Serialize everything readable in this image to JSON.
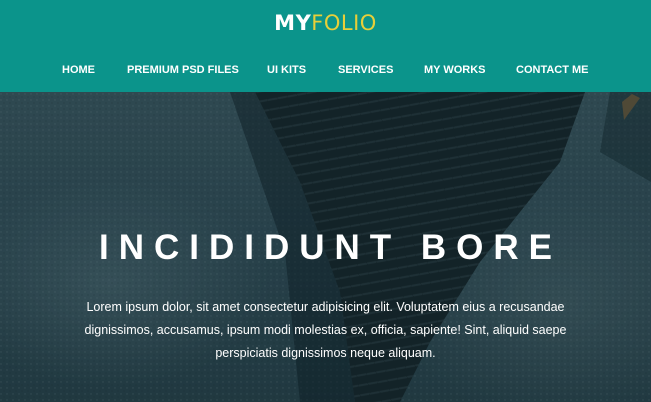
{
  "header": {
    "logo": {
      "part1": "MY",
      "part2": "FOLIO"
    },
    "nav": [
      {
        "label": "HOME"
      },
      {
        "label": "PREMIUM PSD FILES"
      },
      {
        "label": "UI KITS"
      },
      {
        "label": "SERVICES"
      },
      {
        "label": "MY WORKS"
      },
      {
        "label": "CONTACT ME"
      }
    ]
  },
  "hero": {
    "title": "INCIDIDUNT BORE",
    "text": "Lorem ipsum dolor, sit amet consectetur adipisicing elit. Voluptatem eius a recusandae dignissimos, accusamus, ipsum modi molestias ex, officia, sapiente! Sint, aliquid saepe perspiciatis dignissimos neque aliquam."
  },
  "colors": {
    "header_bg": "#0b948b",
    "logo_accent": "#e7cf39",
    "hero_overlay": "#263c44"
  }
}
